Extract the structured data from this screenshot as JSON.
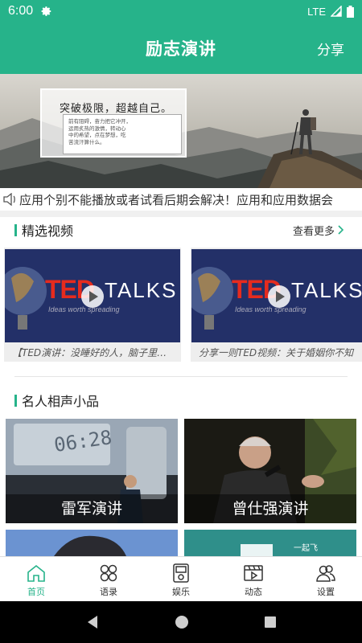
{
  "status_bar": {
    "time": "6:00",
    "network": "LTE"
  },
  "app_bar": {
    "title": "励志演讲",
    "share_label": "分享"
  },
  "banner": {
    "card_title": "突破极限，超越自己。",
    "card_lines": [
      "前有阻碍，奋力把它冲开，",
      "运用炙热的激情，转动心",
      "中的希望，点在梦想，吃",
      "苦流汗算什么。"
    ]
  },
  "notice": {
    "text": "应用个别不能播放或者试看后期会解决！应用和应用数据会"
  },
  "featured": {
    "title": "精选视频",
    "more_label": "查看更多",
    "videos": [
      {
        "caption": "【TED演讲：没睡好的人，脑子里…",
        "logo_left": "TED",
        "logo_right": "TALKS",
        "tagline": "Ideas worth spreading"
      },
      {
        "caption": "分享一则TED视频：关于婚姻你不知",
        "logo_left": "TED",
        "logo_right": "TALKS",
        "tagline": "Ideas worth spreading"
      }
    ]
  },
  "section2": {
    "title": "名人相声小品",
    "tiles": [
      {
        "label": "雷军演讲",
        "overlay_text": "06:28"
      },
      {
        "label": "曾仕强演讲"
      },
      {
        "label": ""
      },
      {
        "label": "",
        "overlay_text": "一起飞"
      }
    ]
  },
  "tabs": [
    {
      "label": "首页",
      "icon": "home-icon",
      "active": true
    },
    {
      "label": "语录",
      "icon": "quotes-icon",
      "active": false
    },
    {
      "label": "娱乐",
      "icon": "entertainment-icon",
      "active": false
    },
    {
      "label": "动态",
      "icon": "video-icon",
      "active": false
    },
    {
      "label": "设置",
      "icon": "settings-icon",
      "active": false
    }
  ],
  "colors": {
    "primary": "#26b38a",
    "active_tab": "#26b38a"
  }
}
